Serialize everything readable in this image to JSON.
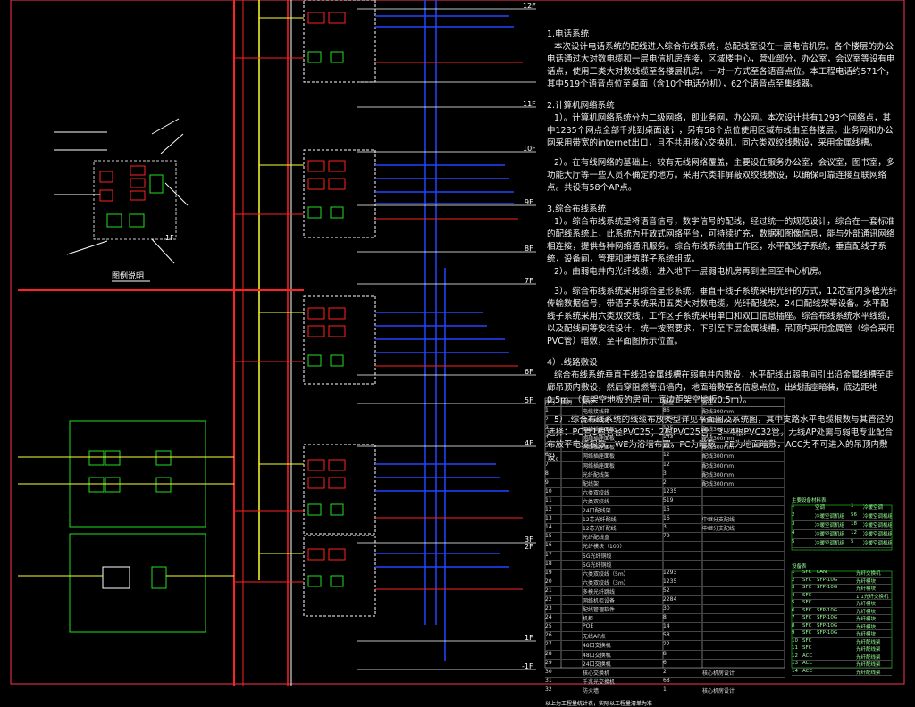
{
  "floors": [
    "12F",
    "11F",
    "10F",
    "9F",
    "8F",
    "7F",
    "6F",
    "5F",
    "4F",
    "3F",
    "2F",
    "1F",
    "-1F"
  ],
  "legend": {
    "title": "图例说明",
    "labels": [
      "1F"
    ]
  },
  "notes": [
    {
      "head": "1.电话系统",
      "body": "本次设计电话系统的配线进入综合布线系统，总配线室设在一层电信机房。各个楼层的办公电话通过大对数电缆和一层电信机房连接，区域楼中心，营业部分，办公室，会议室等设有电话点，使用三类大对数线缆至各楼层机房。一对一方式至各语音点位。本工程电话约571个，其中519个语音点位至桌面（含10个电话分机），62个语音点至集线器。"
    },
    {
      "head": "2.计算机网络系统",
      "body": "1）。计算机网络系统分为二级网络，即业务网，办公网。本次设计共有1293个网络点，其中1235个网点全部千兆到桌面设计，另有58个点位使用区域布线由至各楼层。业务网和办公网采用带宽的internet出口，且不共用核心交换机，同六类双绞线敷设，采用金属线槽。"
    },
    {
      "head": "",
      "body": "2）。在有线网络的基础上，较有无线网络覆盖，主要设在服务办公室，会议室，图书室，多功能大厅等一些人员不确定的地方。采用六类非屏蔽双绞线敷设，以确保可靠连接互联网络点。共设有58个AP点。"
    },
    {
      "head": "3.综合布线系统",
      "body": "1）。综合布线系统是将语音信号，数字信号的配线，经过统一的规范设计，综合在一套标准的配线系统上，此系统为开放式网络平台，可持续扩充，数据和图像信息，能与外部通讯网络相连接，提供各种网络通讯服务。综合布线系统由工作区，水平配线子系统，垂直配线子系统，设备间，管理和建筑群子系统组成。"
    },
    {
      "head": "",
      "body": "2）。由弱电井内光纤线缆，进入地下一层弱电机房再到主回至中心机房。"
    },
    {
      "head": "",
      "body": "3）。综合布线系统采用综合星形系统，垂直干线子系统采用光纤的方式，12芯室内多模光纤传输数据信号，带语子系统采用五类大对数电缆。光纤配线架，24口配线架等设备。水平配线子系统采用六类双绞线，工作区子系统采用单口和双口信息插座。综合布线系统水平线缆，以及配线间等安装设计，统一按照要求，下引至下层金属线槽，吊顶内采用金属管（综合采用PVC管）暗敷，至平面图所示位置。"
    },
    {
      "head": "4）.线路敷设",
      "body": "综合布线系统垂直干线沿金属线槽在弱电井内敷设，水平配线出弱电间引出沿金属线槽至走廊吊顶内敷设，然后穿阻燃管沿墙内，地面暗敷至各信息点位，出线插座暗装，底边距地0.5m。（有架空地板的房间，底边距架空地板0.5m）。"
    },
    {
      "head": "",
      "body": "5）.综合布线系统的线缆布放类型详见平面图及系统图，其中支路水平电缆根数与其管径的选择：PC管1根管径PVC25；2根PVC25管，3~4根PVC32管，无线AP处需与弱电专业配合布放平电缆根数。WE为浴墙布置，FC为暗敷，FE为地面暗敷，ACC为不可进入的吊顶内敷设。"
    }
  ],
  "table": {
    "headers": [
      "序号",
      "图例",
      "名称",
      "数量",
      "备注"
    ],
    "rows": [
      [
        "1",
        "",
        "电缆接线箱",
        "86",
        "配线300mm"
      ],
      [
        "2",
        "",
        "电缆接线箱",
        "123",
        "配线300mm"
      ],
      [
        "3",
        "",
        "网络插座面板",
        "125",
        "配线300mm"
      ],
      [
        "4",
        "",
        "网络插座面板",
        "143",
        "配线300mm"
      ],
      [
        "5",
        "",
        "网络插座面板",
        "287",
        "配线300mm"
      ],
      [
        "6",
        "",
        "网络插座面板",
        "12",
        "配线300mm"
      ],
      [
        "7",
        "",
        "网络插座面板",
        "12",
        "配线300mm"
      ],
      [
        "8",
        "",
        "光纤配线架",
        "3",
        "配线300mm"
      ],
      [
        "9",
        "",
        "配线架",
        "2",
        "配线300mm"
      ],
      [
        "10",
        "",
        "六类双绞线",
        "1235",
        ""
      ],
      [
        "11",
        "",
        "六类双绞线",
        "519",
        ""
      ],
      [
        "12",
        "",
        "24口配线架",
        "15",
        ""
      ],
      [
        "13",
        "",
        "12芯光纤配线",
        "16",
        "中继分支配线"
      ],
      [
        "14",
        "",
        "12芯光纤配线",
        "3",
        "中继分支配线"
      ],
      [
        "15",
        "",
        "光纤配线盒",
        "79",
        ""
      ],
      [
        "16",
        "",
        "光纤模块（100）",
        "",
        ""
      ],
      [
        "17",
        "",
        "5G光纤铜缆",
        "",
        ""
      ],
      [
        "18",
        "",
        "5G光纤铜缆",
        "",
        ""
      ],
      [
        "19",
        "",
        "六类双绞线（5m）",
        "1293",
        ""
      ],
      [
        "20",
        "",
        "六类双绞线（3m）",
        "1235",
        ""
      ],
      [
        "21",
        "",
        "多模光纤跳线",
        "52",
        ""
      ],
      [
        "22",
        "",
        "网络机柜设备",
        "2284",
        ""
      ],
      [
        "23",
        "",
        "配线管理软件",
        "30",
        ""
      ],
      [
        "24",
        "",
        "机柜",
        "8",
        ""
      ],
      [
        "25",
        "",
        "POE",
        "14",
        ""
      ],
      [
        "26",
        "",
        "无线AP点",
        "58",
        ""
      ],
      [
        "27",
        "",
        "48口交换机",
        "22",
        ""
      ],
      [
        "28",
        "",
        "48口交换机",
        "8",
        ""
      ],
      [
        "29",
        "",
        "24口交换机",
        "6",
        ""
      ],
      [
        "30",
        "",
        "核心交换机",
        "2",
        "核心机房设计"
      ],
      [
        "31",
        "",
        "千兆光交换机",
        "68",
        ""
      ],
      [
        "32",
        "",
        "防火墙",
        "1",
        "核心机房设计"
      ]
    ],
    "footnote": "以上为工程量统计表，实际以工程量清单为准"
  },
  "small_table1": {
    "title": "主要设备材料表",
    "rows": [
      [
        "1",
        "",
        "空调",
        "1",
        "冷暖空调"
      ],
      [
        "2",
        "",
        "冷暖空调机组",
        "56",
        "冷暖空调机组"
      ],
      [
        "3",
        "",
        "冷暖空调机组",
        "18",
        "冷暖空调机组"
      ],
      [
        "4",
        "",
        "冷暖空调机组",
        "12",
        "冷暖空调机组"
      ],
      [
        "5",
        "",
        "冷暖空调机组",
        "5",
        "冷暖空调机组"
      ]
    ]
  },
  "small_table2": {
    "title": "设备表",
    "rows": [
      [
        "1",
        "SFC",
        "LAN",
        "",
        "光纤交换机"
      ],
      [
        "2",
        "SFC",
        "SFP-10G",
        "",
        "光纤模块"
      ],
      [
        "3",
        "SFC",
        "SFP-10G",
        "",
        "光纤模块"
      ],
      [
        "4",
        "SFC",
        "",
        "",
        "1:1光纤交换机"
      ],
      [
        "5",
        "SFC",
        "",
        "",
        "光纤模块"
      ],
      [
        "6",
        "SFC",
        "SFP-10G",
        "",
        "光纤模块"
      ],
      [
        "7",
        "SFC",
        "SFP-10G",
        "",
        "光纤模块"
      ],
      [
        "8",
        "SFC",
        "SFP-10G",
        "",
        "光纤模块"
      ],
      [
        "9",
        "SFC",
        "SFP-10G",
        "",
        "光纤模块"
      ],
      [
        "10",
        "SFC",
        "",
        "",
        "光纤配线架"
      ],
      [
        "11",
        "SFC",
        "",
        "",
        "光纤配线架"
      ],
      [
        "12",
        "ACC",
        "",
        "",
        "光纤配线架"
      ],
      [
        "13",
        "ACC",
        "",
        "",
        "光纤配线架"
      ],
      [
        "14",
        "ACC",
        "",
        "",
        "光纤配线架"
      ]
    ]
  },
  "colors": {
    "frame": "#ff3355",
    "red": "#ff2222",
    "green": "#22dd22",
    "yellow": "#ffff33",
    "blue": "#2244ff",
    "white": "#ffffff",
    "gray": "#888888"
  }
}
